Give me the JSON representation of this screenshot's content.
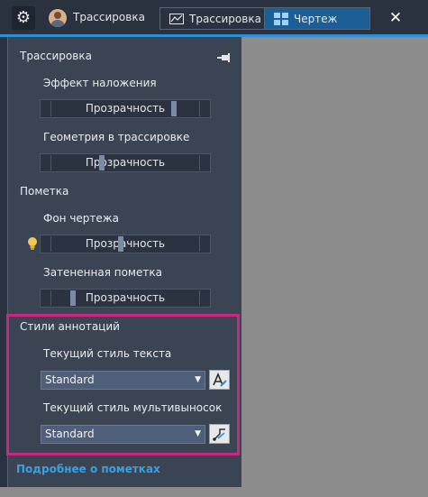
{
  "header": {
    "user_label": "Трассировка",
    "tabs": [
      {
        "label": "Трассировка",
        "icon": "trace-icon",
        "active": false
      },
      {
        "label": "Чертеж",
        "icon": "drawing-icon",
        "active": true
      }
    ]
  },
  "panel": {
    "trace_section": {
      "title": "Трассировка",
      "fade_effect": {
        "label": "Эффект наложения",
        "slider_text": "Прозрачность",
        "value": 0.83
      },
      "trace_geometry": {
        "label": "Геометрия в трассировке",
        "slider_text": "Прозрачность",
        "value": 0.33
      }
    },
    "markup_section": {
      "title": "Пометка",
      "drawing_background": {
        "label": "Фон чертежа",
        "slider_text": "Прозрачность",
        "value": 0.46
      },
      "shaded_markup": {
        "label": "Затененная пометка",
        "slider_text": "Прозрачность",
        "value": 0.13
      }
    },
    "annotation_styles": {
      "title": "Стили аннотаций",
      "text_style": {
        "label": "Текущий стиль текста",
        "value": "Standard"
      },
      "mleader_style": {
        "label": "Текущий стиль мультивыносок",
        "value": "Standard"
      }
    },
    "learn_more_link": "Подробнее о пометках"
  },
  "colors": {
    "accent": "#2b8fd6",
    "highlight_border": "#c8287f",
    "link": "#3aa0e6"
  }
}
